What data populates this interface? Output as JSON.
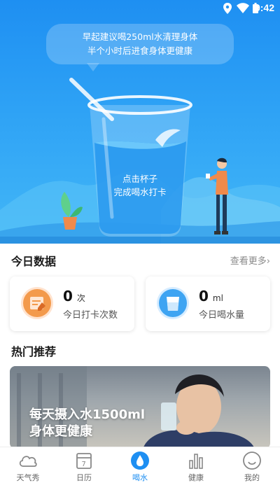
{
  "status_bar": {
    "time": "9:42",
    "icons": [
      "location-icon",
      "wifi-icon",
      "battery-icon"
    ]
  },
  "hero": {
    "tip_line1": "早起建议喝250ml水清理身体",
    "tip_line2": "半个小时后进食身体更健康",
    "cup_line1": "点击杯子",
    "cup_line2": "完成喝水打卡"
  },
  "today": {
    "title": "今日数据",
    "more": "查看更多›",
    "checkins": {
      "value": "0",
      "unit": "次",
      "label": "今日打卡次数"
    },
    "water": {
      "value": "0",
      "unit": "ml",
      "label": "今日喝水量"
    }
  },
  "hot": {
    "title": "热门推荐",
    "banner_line1": "每天摄入水1500ml",
    "banner_line2": "身体更健康"
  },
  "tabs": [
    {
      "label": "天气秀",
      "icon": "cloud-icon"
    },
    {
      "label": "日历",
      "icon": "calendar-icon"
    },
    {
      "label": "喝水",
      "icon": "water-drop-icon",
      "active": true
    },
    {
      "label": "健康",
      "icon": "bar-chart-icon"
    },
    {
      "label": "我的",
      "icon": "smile-icon"
    }
  ],
  "colors": {
    "primary": "#1e8ff2",
    "orange": "#f39a4c",
    "blue_icon": "#3ea4f2"
  }
}
